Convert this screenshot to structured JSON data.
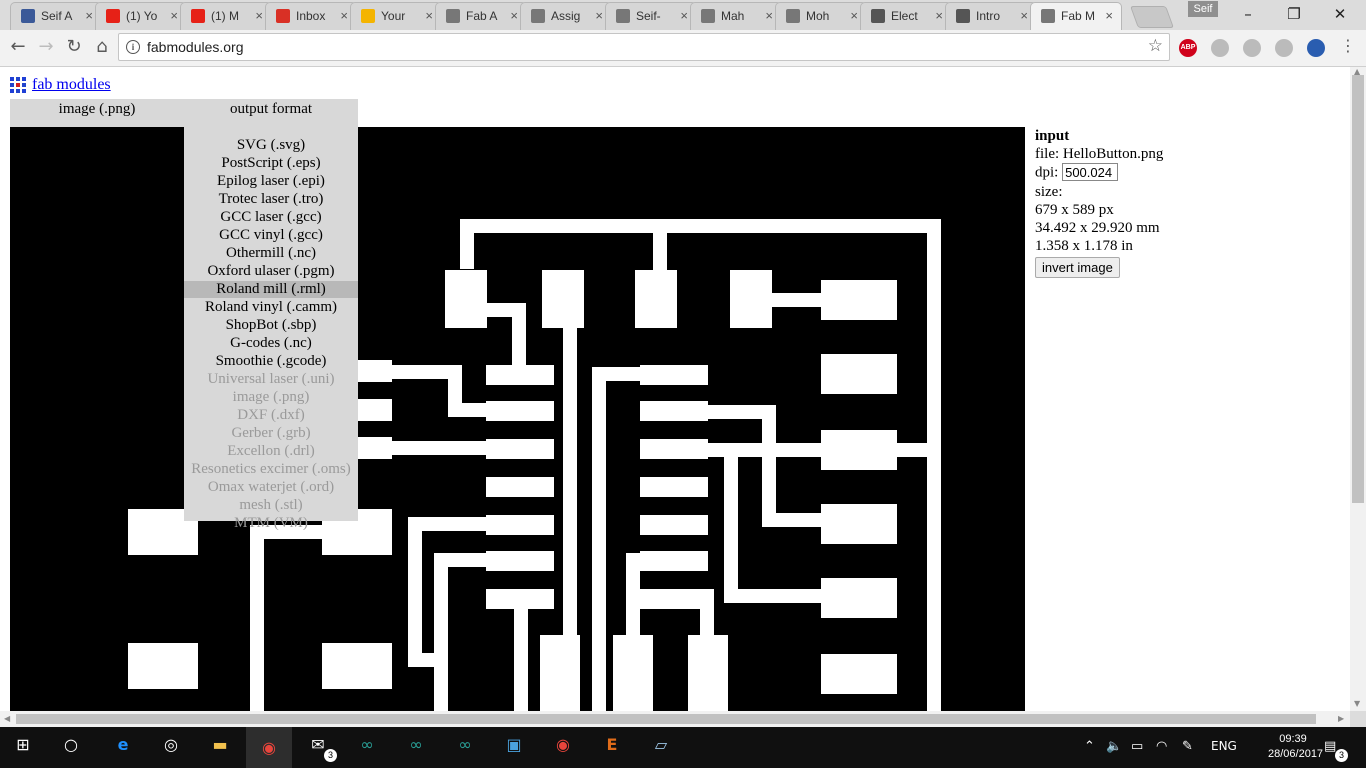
{
  "browser": {
    "tabs": [
      {
        "title": "Seif A",
        "color": "#3b5998",
        "icon": "facebook-icon"
      },
      {
        "title": "(1) Yo",
        "color": "#e62117",
        "icon": "youtube-icon"
      },
      {
        "title": "(1) M",
        "color": "#e62117",
        "icon": "youtube-icon"
      },
      {
        "title": "Inbox",
        "color": "#d93025",
        "icon": "gmail-icon"
      },
      {
        "title": "Your",
        "color": "#f4b400",
        "icon": "gift-icon"
      },
      {
        "title": "Fab A",
        "color": "#777777",
        "icon": "page-icon"
      },
      {
        "title": "Assig",
        "color": "#777777",
        "icon": "page-icon"
      },
      {
        "title": "Seif-",
        "color": "#777777",
        "icon": "page-icon"
      },
      {
        "title": "Mah",
        "color": "#777777",
        "icon": "page-icon"
      },
      {
        "title": "Moh",
        "color": "#777777",
        "icon": "page-icon"
      },
      {
        "title": "Elect",
        "color": "#555555",
        "icon": "book-icon"
      },
      {
        "title": "Intro",
        "color": "#555555",
        "icon": "book-icon"
      },
      {
        "title": "Fab M",
        "color": "#777777",
        "icon": "page-icon"
      }
    ],
    "tab_close": "×",
    "profile_name": "Seif",
    "url": "fabmodules.org",
    "extensions": [
      {
        "label": "ABP",
        "color": "#d0021b"
      },
      {
        "label": "",
        "color": "#bbbbbb"
      },
      {
        "label": "",
        "color": "#bbbbbb"
      },
      {
        "label": "",
        "color": "#bbbbbb"
      },
      {
        "label": "",
        "color": "#2a5db0"
      }
    ]
  },
  "page": {
    "site_link": "fab modules",
    "menu": {
      "input_label": "image (.png)",
      "output_label": "output format"
    },
    "output_options": [
      {
        "label": "SVG (.svg)",
        "enabled": true
      },
      {
        "label": "PostScript (.eps)",
        "enabled": true
      },
      {
        "label": "Epilog laser (.epi)",
        "enabled": true
      },
      {
        "label": "Trotec laser (.tro)",
        "enabled": true
      },
      {
        "label": "GCC laser (.gcc)",
        "enabled": true
      },
      {
        "label": "GCC vinyl (.gcc)",
        "enabled": true
      },
      {
        "label": "Othermill (.nc)",
        "enabled": true
      },
      {
        "label": "Oxford ulaser (.pgm)",
        "enabled": true
      },
      {
        "label": "Roland mill (.rml)",
        "enabled": true,
        "selected": true
      },
      {
        "label": "Roland vinyl (.camm)",
        "enabled": true
      },
      {
        "label": "ShopBot (.sbp)",
        "enabled": true
      },
      {
        "label": "G-codes (.nc)",
        "enabled": true
      },
      {
        "label": "Smoothie (.gcode)",
        "enabled": true
      },
      {
        "label": "Universal laser (.uni)",
        "enabled": false
      },
      {
        "label": "image (.png)",
        "enabled": false
      },
      {
        "label": "DXF (.dxf)",
        "enabled": false
      },
      {
        "label": "Gerber (.grb)",
        "enabled": false
      },
      {
        "label": "Excellon (.drl)",
        "enabled": false
      },
      {
        "label": "Resonetics excimer (.oms)",
        "enabled": false
      },
      {
        "label": "Omax waterjet (.ord)",
        "enabled": false
      },
      {
        "label": "mesh (.stl)",
        "enabled": false
      },
      {
        "label": "MTM (VM)",
        "enabled": false
      }
    ],
    "input_panel": {
      "heading": "input",
      "file_label": "file:",
      "file_name": "HelloButton.png",
      "dpi_label": "dpi:",
      "dpi_value": "500.024",
      "size_label": "size:",
      "size_px": "679 x 589 px",
      "size_mm": "34.492 x 29.920 mm",
      "size_in": "1.358 x 1.178 in",
      "invert_button": "invert image"
    }
  },
  "taskbar": {
    "mail_badge": "3",
    "language": "ENG",
    "time": "09:39",
    "date": "28/06/2017",
    "notification_count": "3"
  }
}
